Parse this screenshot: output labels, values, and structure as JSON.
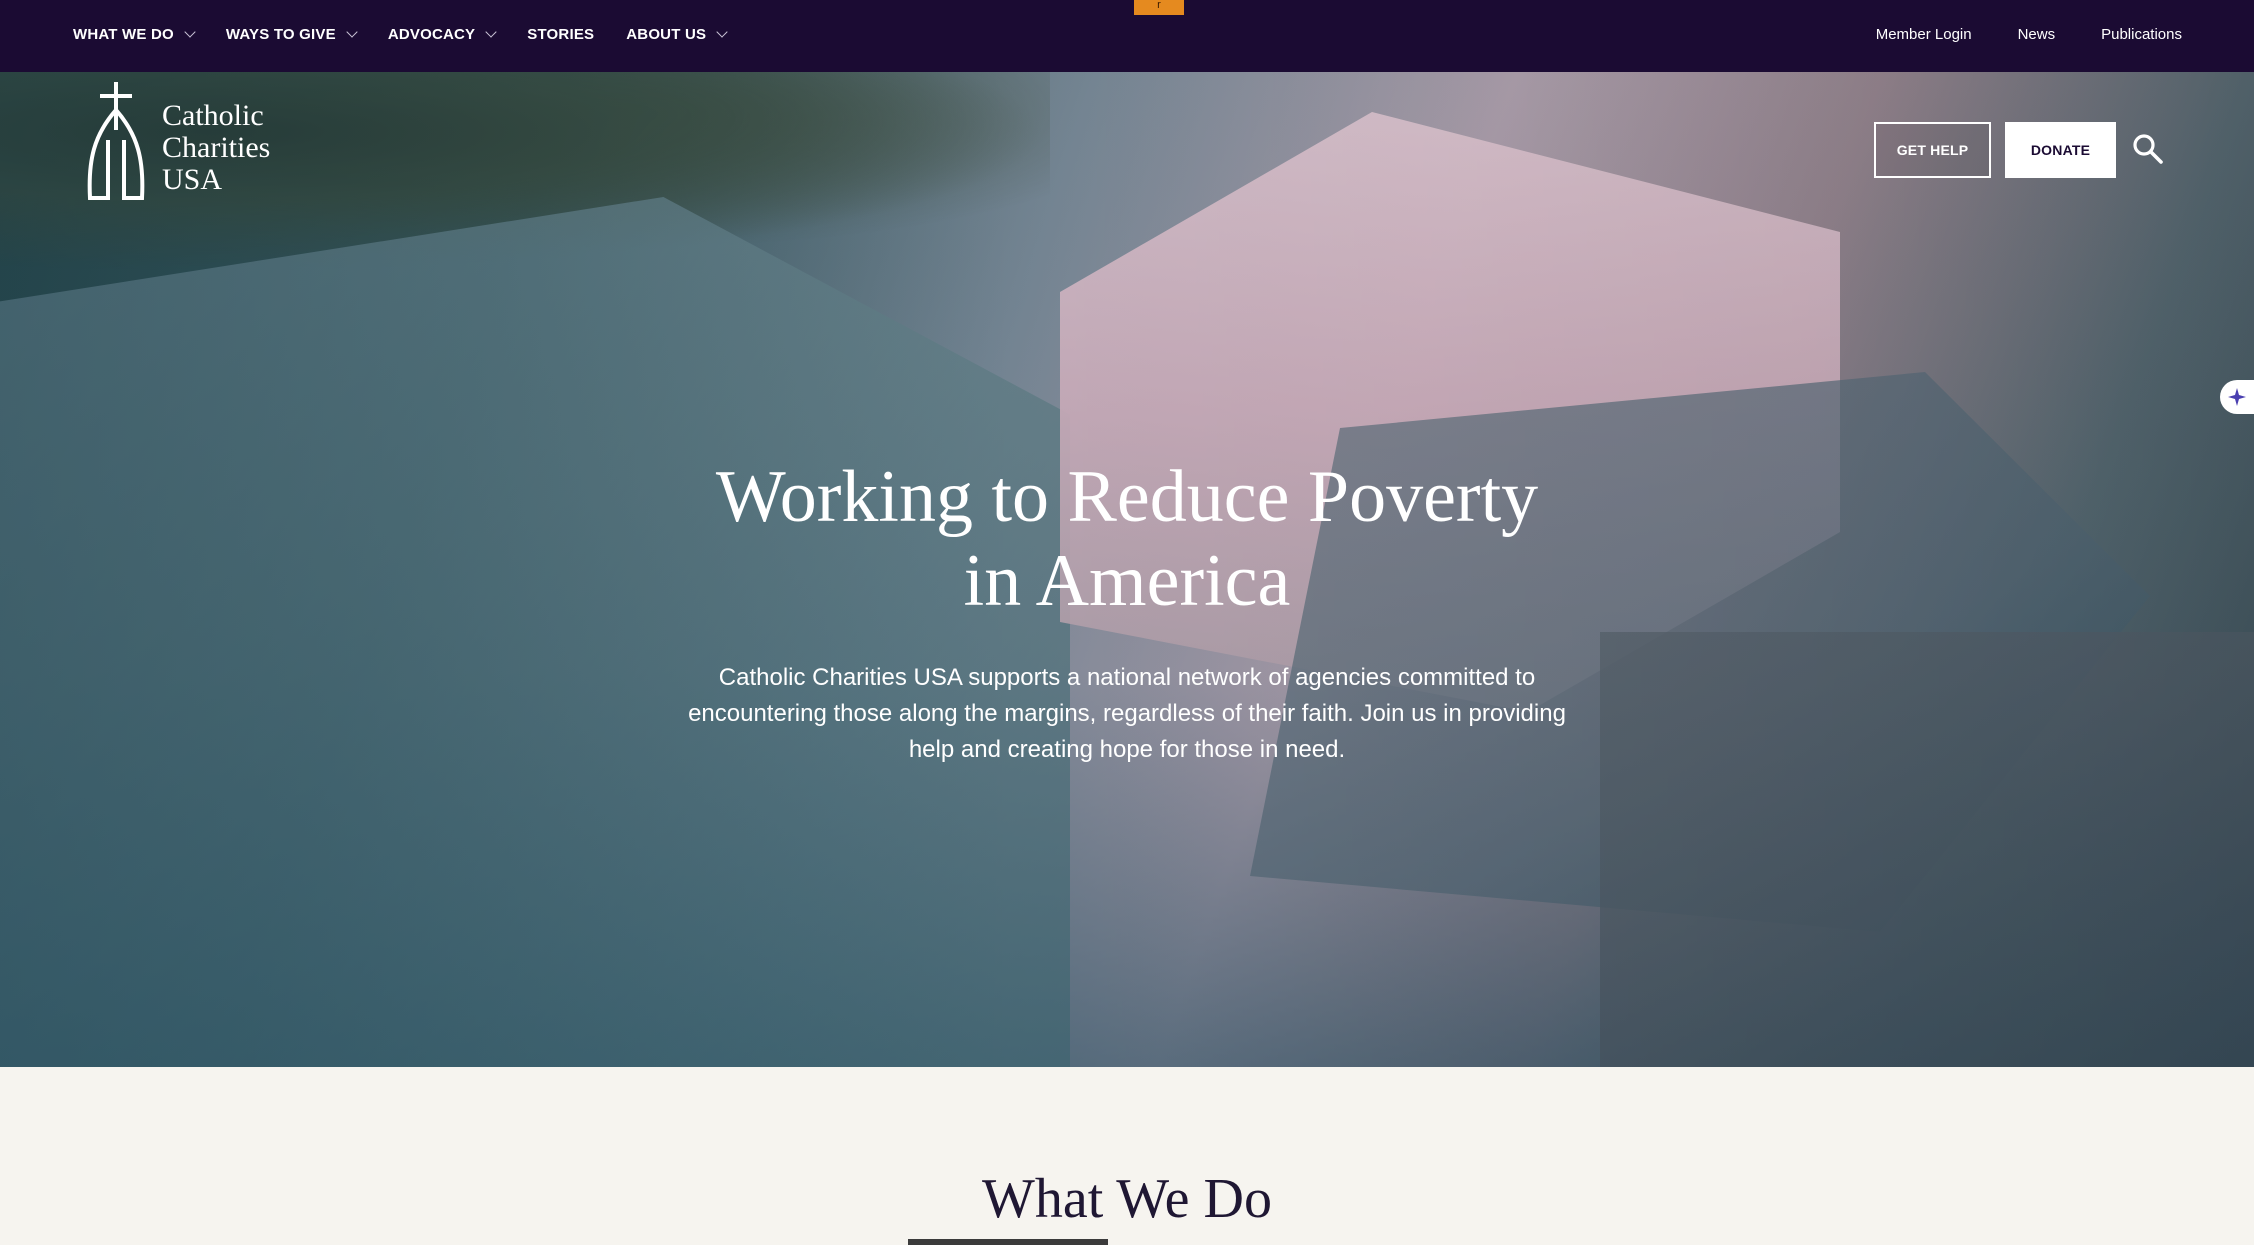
{
  "nav": {
    "primary": [
      {
        "label": "WHAT WE DO",
        "has_dropdown": true
      },
      {
        "label": "WAYS TO GIVE",
        "has_dropdown": true
      },
      {
        "label": "ADVOCACY",
        "has_dropdown": true
      },
      {
        "label": "STORIES",
        "has_dropdown": false
      },
      {
        "label": "ABOUT US",
        "has_dropdown": true
      }
    ],
    "utility": [
      "Member Login",
      "News",
      "Publications"
    ],
    "tab_marker": "r"
  },
  "logo": {
    "line1": "Catholic",
    "line2": "Charities",
    "line3": "USA"
  },
  "header_buttons": {
    "get_help": "GET HELP",
    "donate": "DONATE",
    "search_icon": "search-icon"
  },
  "hero": {
    "title_line1": "Working to Reduce Poverty",
    "title_line2": "in America",
    "subtitle": "Catholic Charities USA supports a national network of agencies committed to encountering those along the margins, regardless of their faith. Join us in providing help and creating hope for those in need."
  },
  "section": {
    "title": "What We Do"
  },
  "colors": {
    "nav_bg": "#1b0b33",
    "accent_orange": "#e58a1f",
    "page_bg": "#f6f4ef"
  }
}
